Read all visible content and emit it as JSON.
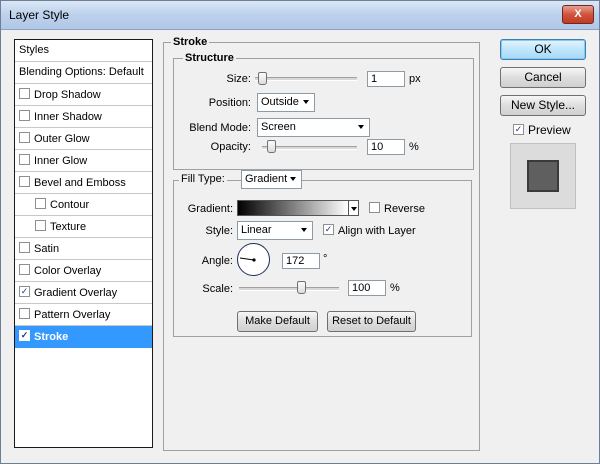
{
  "window": {
    "title": "Layer Style",
    "close_glyph": "X"
  },
  "styles_list": {
    "header": "Styles",
    "blending_options": "Blending Options: Default",
    "items": [
      {
        "label": "Drop Shadow",
        "checked": false,
        "sub": false,
        "selected": false
      },
      {
        "label": "Inner Shadow",
        "checked": false,
        "sub": false,
        "selected": false
      },
      {
        "label": "Outer Glow",
        "checked": false,
        "sub": false,
        "selected": false
      },
      {
        "label": "Inner Glow",
        "checked": false,
        "sub": false,
        "selected": false
      },
      {
        "label": "Bevel and Emboss",
        "checked": false,
        "sub": false,
        "selected": false
      },
      {
        "label": "Contour",
        "checked": false,
        "sub": true,
        "selected": false
      },
      {
        "label": "Texture",
        "checked": false,
        "sub": true,
        "selected": false
      },
      {
        "label": "Satin",
        "checked": false,
        "sub": false,
        "selected": false
      },
      {
        "label": "Color Overlay",
        "checked": false,
        "sub": false,
        "selected": false
      },
      {
        "label": "Gradient Overlay",
        "checked": true,
        "sub": false,
        "selected": false
      },
      {
        "label": "Pattern Overlay",
        "checked": false,
        "sub": false,
        "selected": false
      },
      {
        "label": "Stroke",
        "checked": true,
        "sub": false,
        "selected": true
      }
    ]
  },
  "stroke": {
    "group_title": "Stroke",
    "structure": {
      "title": "Structure",
      "size_label": "Size:",
      "size_value": "1",
      "size_unit": "px",
      "position_label": "Position:",
      "position_value": "Outside",
      "blend_mode_label": "Blend Mode:",
      "blend_mode_value": "Screen",
      "opacity_label": "Opacity:",
      "opacity_value": "10",
      "opacity_unit": "%"
    },
    "fill": {
      "fill_type_label": "Fill Type:",
      "fill_type_value": "Gradient",
      "gradient_label": "Gradient:",
      "reverse_label": "Reverse",
      "reverse_checked": false,
      "style_label": "Style:",
      "style_value": "Linear",
      "align_label": "Align with Layer",
      "align_checked": true,
      "angle_label": "Angle:",
      "angle_value": "172",
      "angle_unit": "°",
      "scale_label": "Scale:",
      "scale_value": "100",
      "scale_unit": "%"
    },
    "make_default_label": "Make Default",
    "reset_default_label": "Reset to Default"
  },
  "right_panel": {
    "ok_label": "OK",
    "cancel_label": "Cancel",
    "new_style_label": "New Style...",
    "preview_label": "Preview",
    "preview_checked": true
  },
  "colors": {
    "selection": "#3399ff",
    "preview_fill": "#5f5f5f"
  }
}
